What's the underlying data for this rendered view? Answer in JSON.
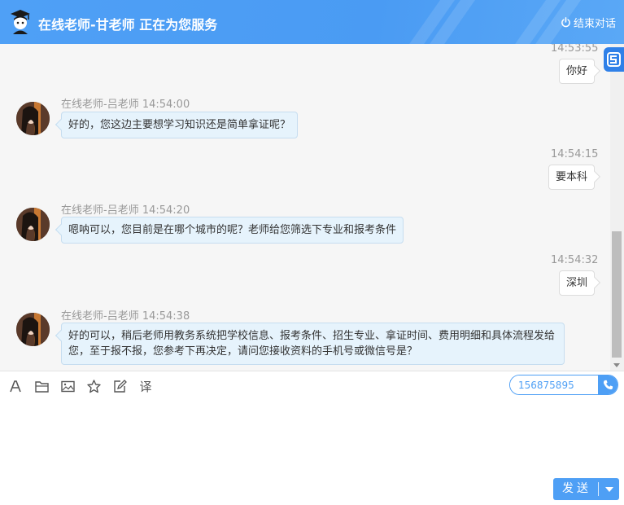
{
  "header": {
    "title": "在线老师-甘老师 正在为您服务",
    "end_label": "结束对话"
  },
  "messages": [
    {
      "side": "right",
      "time": "14:53:55",
      "text": "你好"
    },
    {
      "side": "left",
      "sender": "在线老师-吕老师 14:54:00",
      "text": "好的，您这边主要想学习知识还是简单拿证呢？"
    },
    {
      "side": "right",
      "time": "14:54:15",
      "text": "要本科"
    },
    {
      "side": "left",
      "sender": "在线老师-吕老师 14:54:20",
      "text": "嗯呐可以，您目前是在哪个城市的呢？老师给您筛选下专业和报考条件"
    },
    {
      "side": "right",
      "time": "14:54:32",
      "text": "深圳"
    },
    {
      "side": "left",
      "sender": "在线老师-吕老师 14:54:38",
      "text_line1": "好的可以，稍后老师用教务系统把学校信息、报考条件、招生专业、拿证时间、费用明细和具体流程发给",
      "text_line2": "您，至于报不报，您参考下再决定，请问您接收资料的手机号或微信号是？"
    }
  ],
  "toolbar": {
    "translate_label": "译",
    "phone_value": "156875895"
  },
  "send": {
    "label": "发送"
  },
  "colors": {
    "header": "#4e9ff5",
    "left_bubble": "#e6f3fc",
    "chat_bg": "#f6f6f6"
  }
}
